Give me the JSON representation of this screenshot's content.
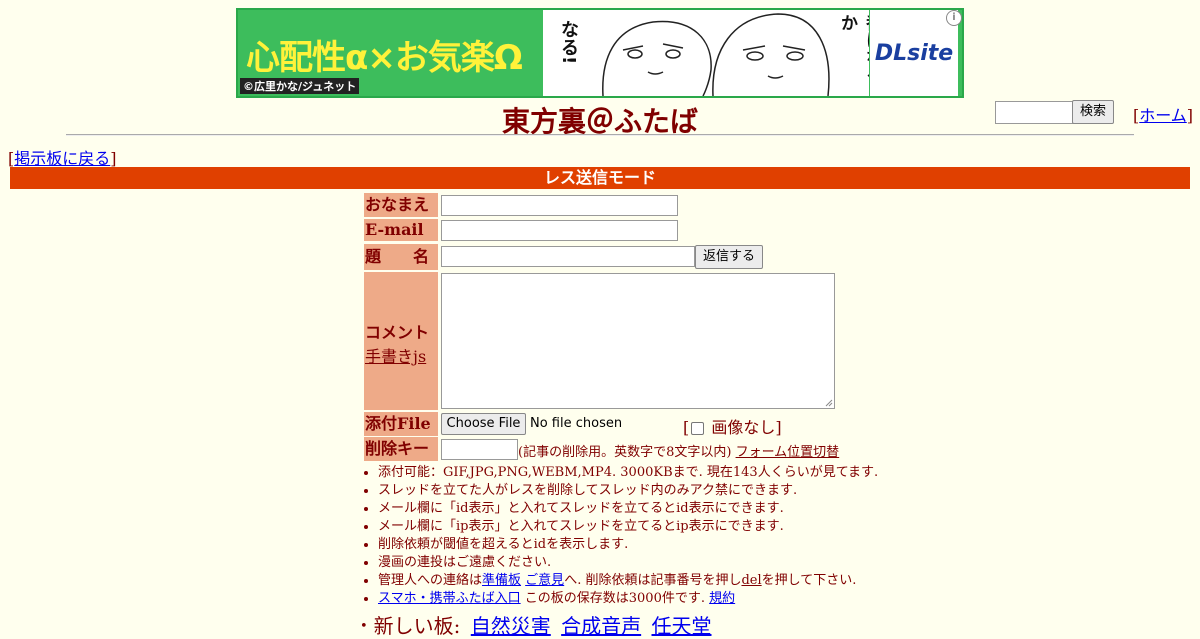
{
  "ad": {
    "title": "心配性α×お気楽Ω",
    "credit": "©広里かな/ジュネット",
    "art_text_1": "なる!",
    "art_text_2": "番になるか",
    "logo": "DLsite",
    "info_icon": "info-icon"
  },
  "header": {
    "title": "東方裏＠ふたば",
    "search_button": "検索",
    "search_value": "",
    "home_link": "ホーム",
    "back_link": "掲示板に戻る"
  },
  "mode_bar": "レス送信モード",
  "form": {
    "name_label": "おなまえ",
    "email_label": "E-mail",
    "subject_label": "題　　名",
    "submit_button": "返信する",
    "comment_label": "コメント",
    "handwrite_link": "手書きjs",
    "attach_label": "添付File",
    "choose_file_button": "Choose File",
    "no_file_text": "No file chosen",
    "no_image_label": "画像なし",
    "delkey_label": "削除キー",
    "delkey_note": "(記事の削除用。英数字で8文字以内)",
    "form_pos_link": "フォーム位置切替"
  },
  "notes": [
    {
      "text": "添付可能：GIF,JPG,PNG,WEBM,MP4. 3000KBまで. 現在143人くらいが見てます."
    },
    {
      "text": "スレッドを立てた人がレスを削除してスレッド内のみアク禁にできます."
    },
    {
      "text": "メール欄に「id表示」と入れてスレッドを立てるとid表示にできます."
    },
    {
      "text": "メール欄に「ip表示」と入れてスレッドを立てるとip表示にできます."
    },
    {
      "text": "削除依頼が閾値を超えるとidを表示します."
    },
    {
      "text": "漫画の連投はご遠慮ください."
    }
  ],
  "contact": {
    "prefix": "管理人への連絡は",
    "link1": "準備板",
    "link2": "ご意見",
    "middle": "へ. 削除依頼は記事番号を押し",
    "del_link": "del",
    "suffix": "を押して下さい."
  },
  "mobile": {
    "link": "スマホ・携帯ふたば入口",
    "text": " この板の保存数は3000件です.",
    "rules_link": "規約"
  },
  "new_boards": {
    "label": "新しい板:",
    "boards": [
      "自然災害",
      "合成音声",
      "任天堂"
    ]
  }
}
